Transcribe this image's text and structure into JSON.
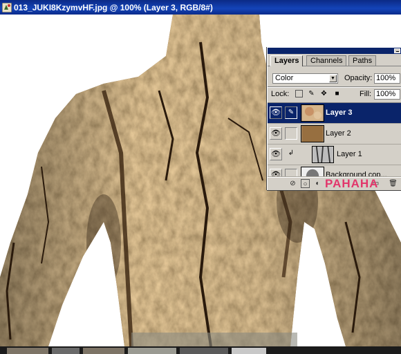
{
  "window": {
    "title": "013_JUKI8KzymvHF.jpg @ 100% (Layer 3, RGB/8#)"
  },
  "layers_panel": {
    "tabs": [
      {
        "label": "Layers",
        "active": true
      },
      {
        "label": "Channels",
        "active": false
      },
      {
        "label": "Paths",
        "active": false
      }
    ],
    "blend_mode": "Color",
    "opacity_label": "Opacity:",
    "opacity_value": "100%",
    "lock_label": "Lock:",
    "fill_label": "Fill:",
    "fill_value": "100%",
    "layers": [
      {
        "name": "Layer 3",
        "selected": true,
        "visible": true,
        "brush_icon": true
      },
      {
        "name": "Layer 2",
        "selected": false,
        "visible": true
      },
      {
        "name": "Layer 1",
        "selected": false,
        "visible": true,
        "clipped": true
      },
      {
        "name": "Background cop...",
        "selected": false,
        "visible": true
      }
    ],
    "footer_icons": [
      "link-icon",
      "add-layer-style-icon",
      "add-mask-icon",
      "adjustment-layer-icon",
      "new-group-icon",
      "new-layer-icon",
      "trash-icon"
    ]
  },
  "watermark": "PAHAHA",
  "colors": {
    "titlebar": "#0a246a",
    "panel_bg": "#d4d0c8",
    "selection": "#0a246a",
    "bark": "#8f6a3c",
    "watermark": "#e2366b"
  }
}
